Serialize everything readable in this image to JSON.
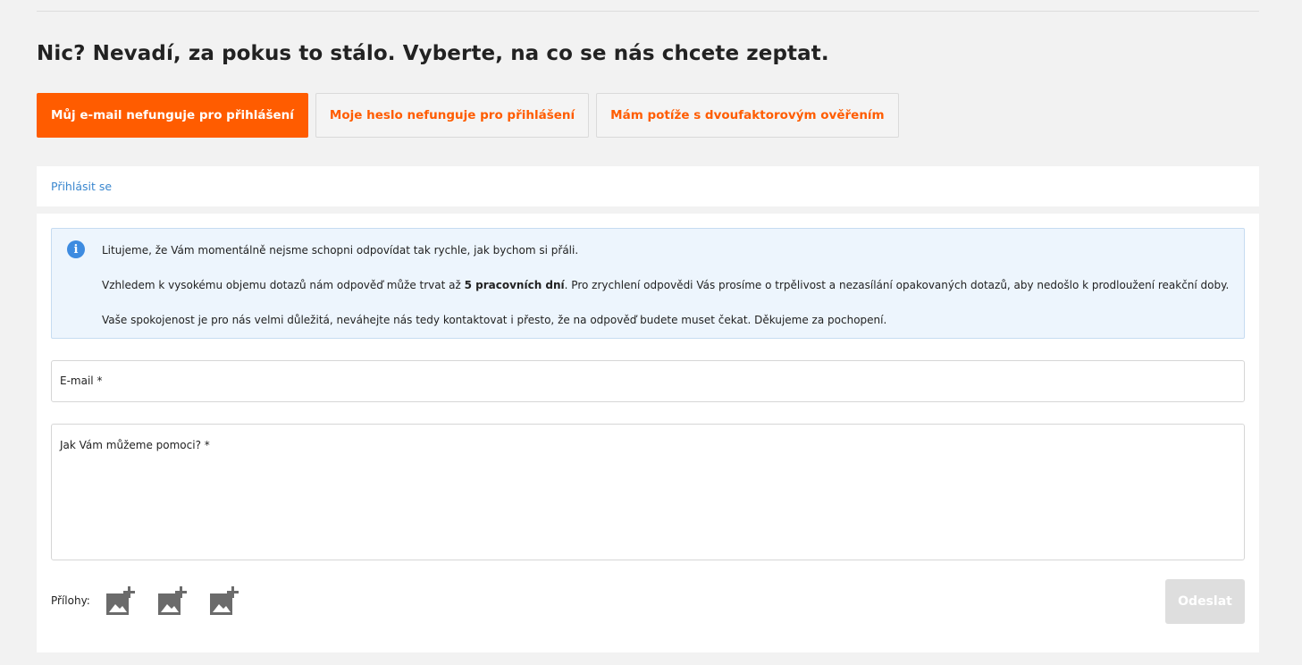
{
  "page_title": "Nic? Nevadí, za pokus to stálo. Vyberte, na co se nás chcete zeptat.",
  "topics": [
    {
      "label": "Můj e-mail nefunguje pro přihlášení",
      "active": true
    },
    {
      "label": "Moje heslo nefunguje pro přihlášení",
      "active": false
    },
    {
      "label": "Mám potíže s dvoufaktorovým ověřením",
      "active": false
    }
  ],
  "login_link": "Přihlásit se",
  "notice": {
    "icon": "info-icon",
    "line1": "Litujeme, že Vám momentálně nejsme schopni odpovídat tak rychle, jak bychom si přáli.",
    "line2_before": "Vzhledem k vysokému objemu dotazů nám odpověď může trvat až ",
    "line2_bold": "5 pracovních dní",
    "line2_after": ". Pro zrychlení odpovědi Vás prosíme o trpělivost a nezasílání opakovaných dotazů, aby nedošlo k prodloužení reakční doby.",
    "line3": "Vaše spokojenost je pro nás velmi důležitá, neváhejte nás tedy kontaktovat i přesto, že na odpověď budete muset čekat. Děkujeme za pochopení."
  },
  "form": {
    "email_label": "E-mail *",
    "message_label": "Jak Vám můžeme pomoci? *",
    "attachments_label": "Přílohy:",
    "attachment_icon": "add-image-icon",
    "submit_label": "Odeslat"
  },
  "colors": {
    "accent": "#ff5c00",
    "link": "#3a87cf",
    "notice_bg": "#edf5fd",
    "info_icon": "#3d8be0",
    "disabled_button": "#dedede"
  }
}
